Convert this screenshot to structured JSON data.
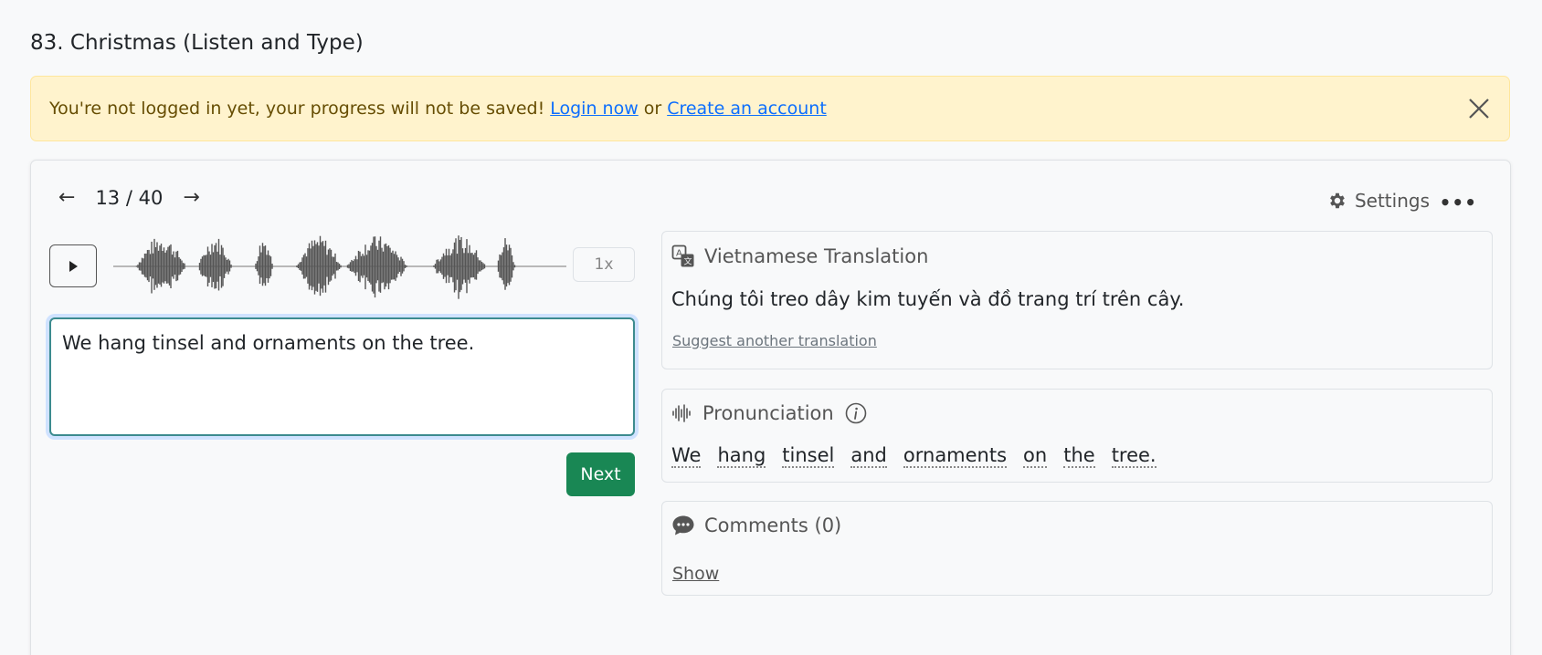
{
  "page": {
    "title": "83. Christmas (Listen and Type)"
  },
  "alert": {
    "message": "You're not logged in yet, your progress will not be saved!",
    "login_link": "Login now",
    "or_text": "or",
    "create_link": "Create an account",
    "bg_color": "#fff3cd"
  },
  "nav": {
    "prev_arrow": "←",
    "counter": "13 / 40",
    "next_arrow": "→"
  },
  "toolbar": {
    "settings_label": "Settings",
    "more_label": "•••"
  },
  "player": {
    "speed": "1x"
  },
  "answer": {
    "value": "We hang tinsel and ornaments on the tree."
  },
  "actions": {
    "next_label": "Next",
    "next_color": "#198754"
  },
  "translation": {
    "title": "Vietnamese Translation",
    "text": "Chúng tôi treo dây kim tuyến và đồ trang trí trên cây.",
    "suggest_label": "Suggest another translation"
  },
  "pronunciation": {
    "title": "Pronunciation",
    "words": [
      "We",
      "hang",
      "tinsel",
      "and",
      "ornaments",
      "on",
      "the",
      "tree."
    ]
  },
  "comments": {
    "title": "Comments (0)",
    "show_label": "Show"
  }
}
